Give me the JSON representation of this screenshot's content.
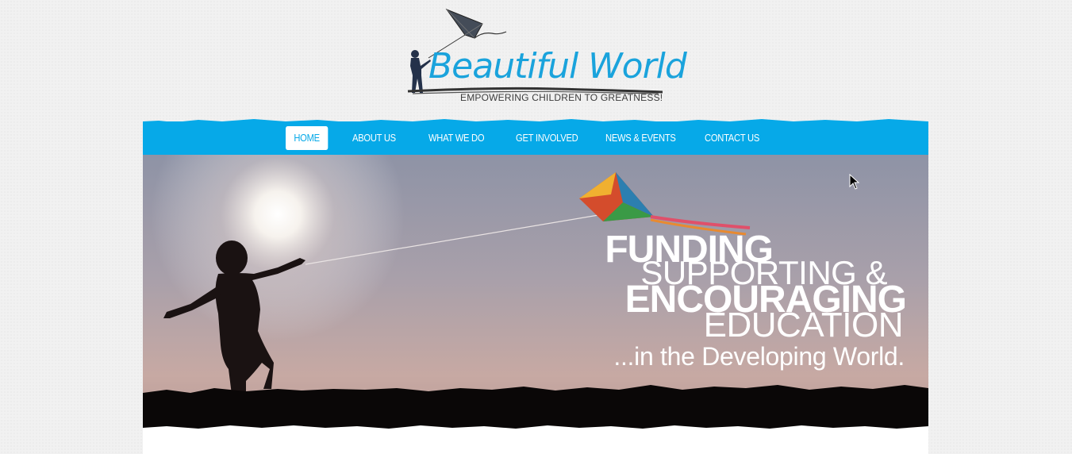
{
  "logo": {
    "word": "Beautiful World",
    "tagline": "EMPOWERING CHILDREN TO GREATNESS!"
  },
  "nav": {
    "items": [
      {
        "label": "HOME",
        "active": true
      },
      {
        "label": "ABOUT US"
      },
      {
        "label": "WHAT WE DO"
      },
      {
        "label": "GET INVOLVED"
      },
      {
        "label": "NEWS & EVENTS"
      },
      {
        "label": "CONTACT US"
      }
    ]
  },
  "hero": {
    "line1": "FUNDING",
    "line2": "SUPPORTING &",
    "line3": "ENCOURAGING",
    "line4": "EDUCATION",
    "line5": "...in the Developing World."
  },
  "colors": {
    "brand_blue": "#06a9e8",
    "logo_blue": "#1aa3dc",
    "page_bg": "#f1f1f1"
  },
  "icons": [
    "kite-icon",
    "child-silhouette-icon",
    "mouse-cursor-icon"
  ]
}
